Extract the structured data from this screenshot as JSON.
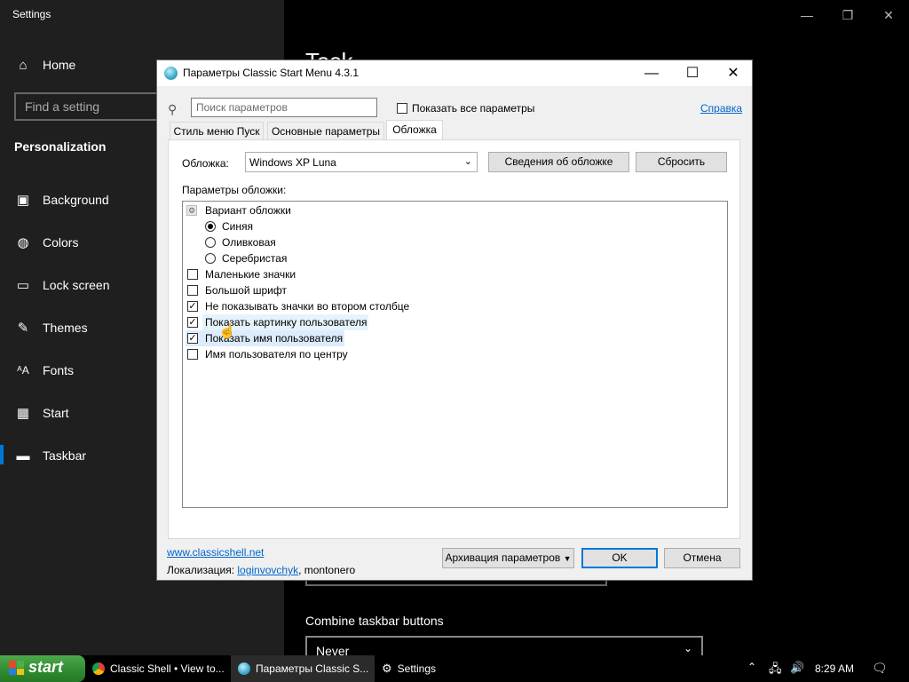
{
  "settings": {
    "window_title": "Settings",
    "nav_home": "Home",
    "search_placeholder": "Find a setting",
    "section": "Personalization",
    "nav_items": [
      {
        "label": "Background",
        "icon": "image-icon"
      },
      {
        "label": "Colors",
        "icon": "palette-icon"
      },
      {
        "label": "Lock screen",
        "icon": "lock-screen-icon"
      },
      {
        "label": "Themes",
        "icon": "brush-icon"
      },
      {
        "label": "Fonts",
        "icon": "font-icon"
      },
      {
        "label": "Start",
        "icon": "start-icon"
      },
      {
        "label": "Taskbar",
        "icon": "taskbar-icon"
      }
    ],
    "selected_item": "Taskbar",
    "main_heading_partial": "Task",
    "combine_label": "Combine taskbar buttons",
    "combine_value": "Never"
  },
  "dialog": {
    "title": "Параметры Classic Start Menu 4.3.1",
    "search_placeholder": "Поиск параметров",
    "show_all_label": "Показать все параметры",
    "help_link": "Справка",
    "tabs": [
      "Стиль меню Пуск",
      "Основные параметры",
      "Обложка"
    ],
    "active_tab": "Обложка",
    "skin_label": "Обложка:",
    "skin_value": "Windows XP Luna",
    "skin_info_button": "Сведения об обложке",
    "reset_button": "Сбросить",
    "skin_params_label": "Параметры обложки:",
    "variant_label": "Вариант обложки",
    "variants": [
      {
        "label": "Синяя",
        "selected": true
      },
      {
        "label": "Оливковая",
        "selected": false
      },
      {
        "label": "Серебристая",
        "selected": false
      }
    ],
    "options": [
      {
        "label": "Маленькие значки",
        "checked": false
      },
      {
        "label": "Большой шрифт",
        "checked": false
      },
      {
        "label": "Не показывать значки во втором столбце",
        "checked": true
      },
      {
        "label": "Показать картинку пользователя",
        "checked": true
      },
      {
        "label": "Показать имя пользователя",
        "checked": true
      },
      {
        "label": "Имя пользователя по центру",
        "checked": false
      }
    ],
    "website_link": "www.classicshell.net",
    "localization_label": "Локализация:",
    "localization_author1": "loginvovchyk",
    "localization_author2": ", montonero",
    "backup_button": "Архивация параметров",
    "ok_button": "OK",
    "cancel_button": "Отмена"
  },
  "taskbar": {
    "start_label": "start",
    "tasks": [
      {
        "label": "Classic Shell • View to..."
      },
      {
        "label": "Параметры Classic S..."
      },
      {
        "label": "Settings"
      }
    ],
    "time": "8:29 AM"
  }
}
